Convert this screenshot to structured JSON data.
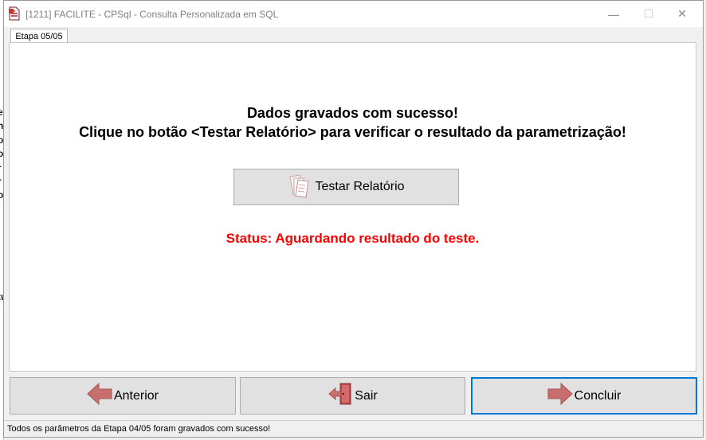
{
  "window": {
    "title": "[1211] FACILITE - CPSql - Consulta Personalizada em SQL",
    "minimize_glyph": "—",
    "maximize_glyph": "☐",
    "close_glyph": "✕"
  },
  "tabs": [
    {
      "label": "Etapa 05/05",
      "active": true
    }
  ],
  "main": {
    "message_line1": "Dados gravados com sucesso!",
    "message_line2": "Clique no botão <Testar Relatório> para verificar o resultado da parametrização!",
    "test_button_label": "Testar Relatório",
    "test_button_icon": "documents-icon",
    "status_text": "Status: Aguardando resultado do teste.",
    "status_color": "#ff0000"
  },
  "navigation": {
    "previous_label": "Anterior",
    "previous_icon": "arrow-left-icon",
    "exit_label": "Sair",
    "exit_icon": "exit-door-icon",
    "finish_label": "Concluir",
    "finish_icon": "arrow-right-icon"
  },
  "statusbar": {
    "text": "Todos os parâmetros da Etapa 04/05 foram gravados com sucesso!"
  },
  "colors": {
    "accent": "#0078d7",
    "arrow": "#c96e6e",
    "status_red": "#ff0000"
  },
  "background_window_fragments": [
    "e",
    "n",
    "o",
    "o",
    "r",
    "r",
    "o",
    "tu"
  ]
}
